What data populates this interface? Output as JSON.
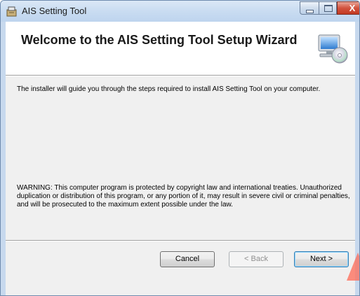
{
  "window": {
    "title": "AIS Setting Tool",
    "controls": {
      "minimize_icon": "minimize-icon",
      "maximize_icon": "maximize-icon",
      "close_icon": "close-icon",
      "close_glyph": "X"
    }
  },
  "banner": {
    "title": "Welcome to the AIS Setting Tool Setup Wizard",
    "icon": "computer-disc-icon"
  },
  "content": {
    "intro": "The installer will guide you through the steps required to install AIS Setting Tool on your computer.",
    "warning": "WARNING: This computer program is protected by copyright law and international treaties. Unauthorized duplication or distribution of this program, or any portion of it, may result in severe civil or criminal penalties, and will be prosecuted to the maximum extent possible under the law."
  },
  "buttons": {
    "cancel": "Cancel",
    "back": "< Back",
    "next": "Next >"
  },
  "colors": {
    "accent": "#3c7fb1",
    "close_red": "#c33a22"
  }
}
